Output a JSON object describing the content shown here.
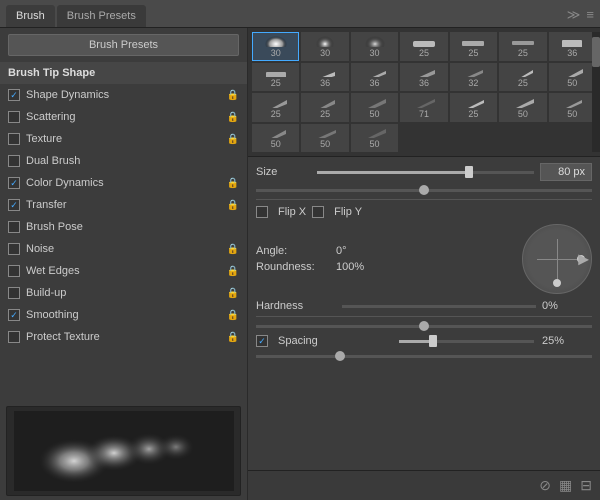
{
  "tabs": {
    "brush": "Brush",
    "brush_presets": "Brush Presets"
  },
  "toolbar": {
    "brush_presets_button": "Brush Presets"
  },
  "menu_items": [
    {
      "id": "brush-tip-shape",
      "label": "Brush Tip Shape",
      "type": "header",
      "active": true
    },
    {
      "id": "shape-dynamics",
      "label": "Shape Dynamics",
      "checked": true,
      "hasLock": true
    },
    {
      "id": "scattering",
      "label": "Scattering",
      "checked": false,
      "hasLock": true
    },
    {
      "id": "texture",
      "label": "Texture",
      "checked": false,
      "hasLock": true
    },
    {
      "id": "dual-brush",
      "label": "Dual Brush",
      "checked": false,
      "hasLock": false
    },
    {
      "id": "color-dynamics",
      "label": "Color Dynamics",
      "checked": true,
      "hasLock": true
    },
    {
      "id": "transfer",
      "label": "Transfer",
      "checked": true,
      "hasLock": true
    },
    {
      "id": "brush-pose",
      "label": "Brush Pose",
      "checked": false,
      "hasLock": false
    },
    {
      "id": "noise",
      "label": "Noise",
      "checked": false,
      "hasLock": true
    },
    {
      "id": "wet-edges",
      "label": "Wet Edges",
      "checked": false,
      "hasLock": true
    },
    {
      "id": "build-up",
      "label": "Build-up",
      "checked": false,
      "hasLock": true
    },
    {
      "id": "smoothing",
      "label": "Smoothing",
      "checked": true,
      "hasLock": true
    },
    {
      "id": "protect-texture",
      "label": "Protect Texture",
      "checked": false,
      "hasLock": true
    }
  ],
  "brush_grid": {
    "rows": [
      [
        {
          "size": 30,
          "shape": "round",
          "selected": true
        },
        {
          "size": 30,
          "shape": "round"
        },
        {
          "size": 30,
          "shape": "round"
        },
        {
          "size": 25,
          "shape": "flat"
        },
        {
          "size": 25,
          "shape": "flat"
        },
        {
          "size": 25,
          "shape": "flat"
        },
        {
          "size": null,
          "shape": "scrollbar"
        }
      ],
      [
        {
          "size": 36,
          "shape": "flat"
        },
        {
          "size": 25,
          "shape": "flat"
        },
        {
          "size": 36,
          "shape": "angled"
        },
        {
          "size": 36,
          "shape": "angled"
        },
        {
          "size": 36,
          "shape": "angled"
        },
        {
          "size": 32,
          "shape": "angled"
        }
      ],
      [
        {
          "size": 25,
          "shape": "flat2"
        },
        {
          "size": 50,
          "shape": "flat2"
        },
        {
          "size": 25,
          "shape": "flat2"
        },
        {
          "size": 25,
          "shape": "flat2"
        },
        {
          "size": 50,
          "shape": "flat2"
        },
        {
          "size": 71,
          "shape": "flat2"
        }
      ],
      [
        {
          "size": 25,
          "shape": "flat3"
        },
        {
          "size": 50,
          "shape": "flat3"
        },
        {
          "size": 50,
          "shape": "flat3"
        },
        {
          "size": 50,
          "shape": "flat3"
        },
        {
          "size": 50,
          "shape": "flat3"
        },
        {
          "size": 50,
          "shape": "flat3"
        }
      ]
    ]
  },
  "controls": {
    "size_label": "Size",
    "size_value": "80 px",
    "size_percent": 70,
    "flip_x": "Flip X",
    "flip_y": "Flip Y",
    "angle_label": "Angle:",
    "angle_value": "0°",
    "roundness_label": "Roundness:",
    "roundness_value": "100%",
    "hardness_label": "Hardness",
    "hardness_value": "0%",
    "spacing_label": "Spacing",
    "spacing_value": "25%",
    "spacing_checked": true
  },
  "bottom_icons": {
    "icon1": "⊘",
    "icon2": "▦",
    "icon3": "⊟"
  }
}
